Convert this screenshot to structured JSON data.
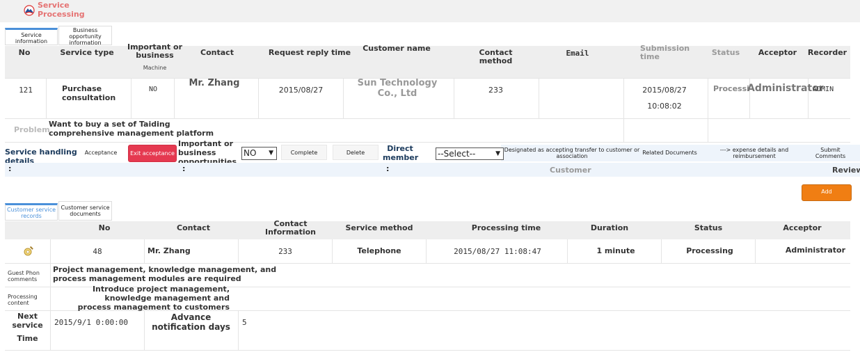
{
  "app": {
    "title": "Service Processing"
  },
  "tabs_top": [
    {
      "label": "Service information",
      "active": true
    },
    {
      "label": "Business opportunity information",
      "active": false
    }
  ],
  "service_table": {
    "headers": {
      "no": "No",
      "service_type": "Service type",
      "important": "Important or business",
      "machine": "Machine",
      "contact": "Contact",
      "request_reply_time": "Request reply time",
      "customer_name": "Customer name",
      "contact_method": "Contact method",
      "email": "Email",
      "submission_time": "Submission time",
      "status": "Status",
      "acceptor": "Acceptor",
      "recorder": "Recorder"
    },
    "row": {
      "no": "121",
      "service_type": "Purchase consultation",
      "important": "NO",
      "contact": "Mr. Zhang",
      "request_reply_time": "2015/08/27",
      "customer_name": "Sun Technology Co., Ltd",
      "contact_method": "233",
      "email": "",
      "submission_date": "2015/08/27",
      "submission_clock": "10:08:02",
      "status": "Processing",
      "acceptor": "Administrator",
      "recorder": "ADMIN"
    },
    "problem_label": "Problem",
    "problem_text": "Want to buy a set of Taiding comprehensive management platform"
  },
  "handling": {
    "label": "Service handling details",
    "acceptance": "Acceptance",
    "exit_acceptance": "Exit acceptance",
    "important_label": "Important or business opportunities",
    "important_value": "NO",
    "complete": "Complete",
    "delete": "Delete",
    "direct_member": "Direct member",
    "select_value": "--Select--",
    "designated": "Designated as accepting transfer to customer or association",
    "related_documents": "Related Documents",
    "expense": "---> expense details and reimbursement",
    "submit_comments": "Submit Comments",
    "colon": ":",
    "customer": "Customer",
    "review": "Review",
    "add": "Add"
  },
  "tabs_bottom": [
    {
      "label": "Customer service records",
      "active": true
    },
    {
      "label": "Customer service documents",
      "active": false
    }
  ],
  "records_table": {
    "headers": {
      "no": "No",
      "contact": "Contact",
      "contact_info": "Contact Information",
      "service_method": "Service method",
      "processing_time": "Processing time",
      "duration": "Duration",
      "status": "Status",
      "acceptor": "Acceptor"
    },
    "row": {
      "no": "48",
      "contact": "Mr. Zhang",
      "contact_info": "233",
      "service_method": "Telephone",
      "processing_time": "2015/08/27 11:08:47",
      "duration": "1 minute",
      "status": "Processing",
      "acceptor": "Administrator"
    },
    "guest_label": "Guest Phon comments",
    "guest_text": "Project management, knowledge management, and process management modules are required",
    "processing_label": "Processing content",
    "processing_text": "Introduce project management, knowledge management and process management to customers",
    "next_service_label_1": "Next service",
    "next_service_label_2": "Time",
    "next_service_value": "2015/9/1 0:00:00",
    "advance_label": "Advance notification days",
    "advance_value": "5"
  }
}
